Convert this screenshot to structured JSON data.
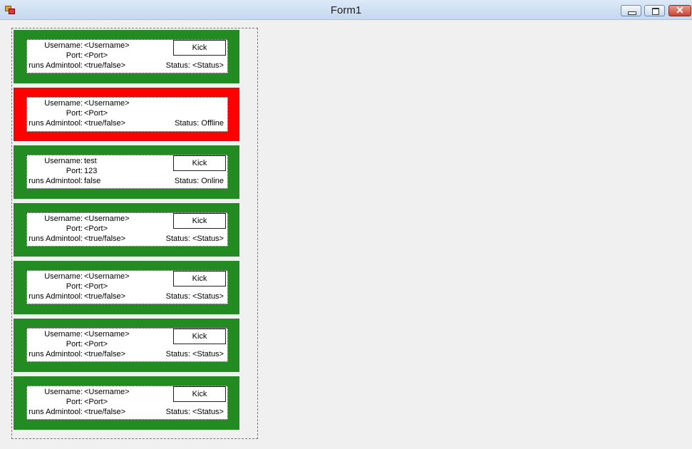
{
  "window": {
    "title": "Form1"
  },
  "labels": {
    "username": "Username:",
    "port": "Port:",
    "admintool": "runs Admintool:",
    "status": "Status:"
  },
  "cards": [
    {
      "username": "<Username>",
      "port": "<Port>",
      "admintool": "<true/false>",
      "status": "<Status>",
      "kick": "Kick",
      "color": "#228b22"
    },
    {
      "username": "<Username>",
      "port": "<Port>",
      "admintool": "<true/false>",
      "status": "Offline",
      "kick": "",
      "color": "#ff0000"
    },
    {
      "username": "test",
      "port": "123",
      "admintool": "false",
      "status": "Online",
      "kick": "Kick",
      "color": "#228b22"
    },
    {
      "username": "<Username>",
      "port": "<Port>",
      "admintool": "<true/false>",
      "status": "<Status>",
      "kick": "Kick",
      "color": "#228b22"
    },
    {
      "username": "<Username>",
      "port": "<Port>",
      "admintool": "<true/false>",
      "status": "<Status>",
      "kick": "Kick",
      "color": "#228b22"
    },
    {
      "username": "<Username>",
      "port": "<Port>",
      "admintool": "<true/false>",
      "status": "<Status>",
      "kick": "Kick",
      "color": "#228b22"
    },
    {
      "username": "<Username>",
      "port": "<Port>",
      "admintool": "<true/false>",
      "status": "<Status>",
      "kick": "Kick",
      "color": "#228b22"
    }
  ]
}
